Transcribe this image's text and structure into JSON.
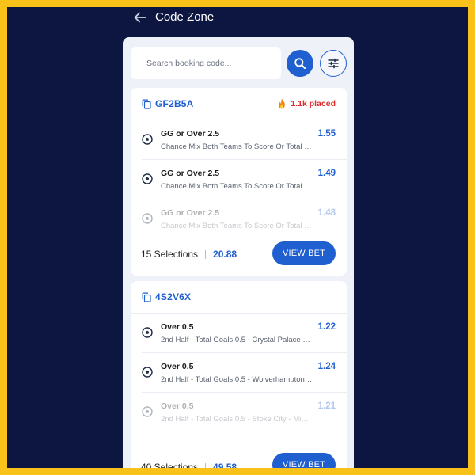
{
  "header": {
    "title": "Code Zone",
    "back_icon": "arrow-left-icon"
  },
  "search": {
    "placeholder": "Search booking code...",
    "search_icon": "search-icon",
    "filter_icon": "sliders-icon"
  },
  "colors": {
    "background": "#0c1640",
    "border": "#f8c21a",
    "accent": "#1f5fcf",
    "hot": "#e02b2b"
  },
  "codes": [
    {
      "code": "GF2B5A",
      "placed": "1.1k placed",
      "selections": [
        {
          "pick": "GG or Over 2.5",
          "market": "Chance Mix Both Teams To Score Or Total G...",
          "odds": "1.55"
        },
        {
          "pick": "GG or Over 2.5",
          "market": "Chance Mix Both Teams To Score Or Total G...",
          "odds": "1.49"
        },
        {
          "pick": "GG or Over 2.5",
          "market": "Chance Mix Both Teams To Score Or Total G...",
          "odds": "1.48"
        }
      ],
      "selections_label": "15 Selections",
      "total_odds": "20.88",
      "button": "VIEW BET"
    },
    {
      "code": "4S2V6X",
      "placed": "",
      "selections": [
        {
          "pick": "Over 0.5",
          "market": "2nd Half - Total Goals 0.5 - Crystal Palace - A...",
          "odds": "1.22"
        },
        {
          "pick": "Over 0.5",
          "market": "2nd Half - Total Goals 0.5 - Wolverhampton ...",
          "odds": "1.24"
        },
        {
          "pick": "Over 0.5",
          "market": "2nd Half - Total Goals 0.5 - Stoke City - Midd...",
          "odds": "1.21"
        }
      ],
      "selections_label": "40 Selections",
      "total_odds": "49.58",
      "button": "VIEW BET"
    }
  ]
}
